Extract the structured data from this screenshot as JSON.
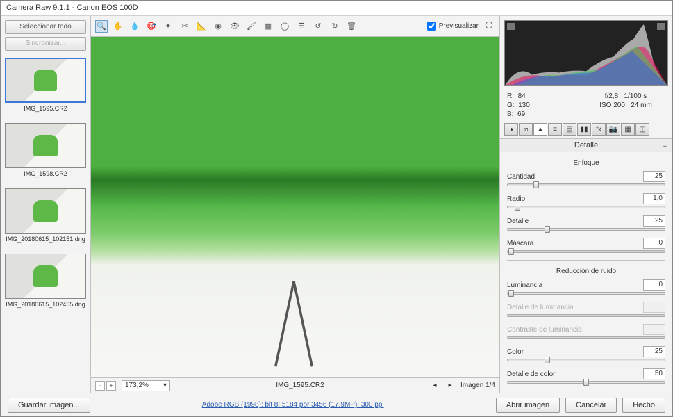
{
  "window": {
    "title": "Camera Raw 9.1.1  -  Canon EOS 100D"
  },
  "filmstrip": {
    "select_all": "Seleccionar todo",
    "sync": "Sincronizar...",
    "thumbs": [
      {
        "label": "IMG_1595.CR2"
      },
      {
        "label": "IMG_1598.CR2"
      },
      {
        "label": "IMG_20180615_102151.dng"
      },
      {
        "label": "IMG_20180615_102455.dng"
      }
    ]
  },
  "toolbar": {
    "preview_label": "Previsualizar"
  },
  "status": {
    "zoom": "173,2%",
    "filename": "IMG_1595.CR2",
    "counter": "Imagen  1/4"
  },
  "info": {
    "r_label": "R:",
    "r": "84",
    "g_label": "G:",
    "g": "130",
    "b_label": "B:",
    "b": "69",
    "aperture": "f/2,8",
    "shutter": "1/100 s",
    "iso": "ISO 200",
    "focal": "24 mm"
  },
  "panel": {
    "title": "Detalle",
    "enfoque_title": "Enfoque",
    "ruido_title": "Reducción de ruido",
    "sliders": {
      "cantidad": {
        "label": "Cantidad",
        "value": "25",
        "pos": 18
      },
      "radio": {
        "label": "Radio",
        "value": "1,0",
        "pos": 6
      },
      "detalle": {
        "label": "Detalle",
        "value": "25",
        "pos": 25
      },
      "mascara": {
        "label": "Máscara",
        "value": "0",
        "pos": 2
      },
      "luminancia": {
        "label": "Luminancia",
        "value": "0",
        "pos": 2
      },
      "det_lum": {
        "label": "Detalle de luminancia",
        "value": "",
        "pos": 50
      },
      "con_lum": {
        "label": "Contraste de luminancia",
        "value": "",
        "pos": 50
      },
      "color": {
        "label": "Color",
        "value": "25",
        "pos": 25
      },
      "det_color": {
        "label": "Detalle de color",
        "value": "50",
        "pos": 50
      }
    }
  },
  "footer": {
    "save": "Guardar imagen...",
    "workflow": "Adobe RGB (1998); bit 8; 5184 por 3456 (17,9MP); 300 ppi",
    "open": "Abrir imagen",
    "cancel": "Cancelar",
    "done": "Hecho"
  }
}
